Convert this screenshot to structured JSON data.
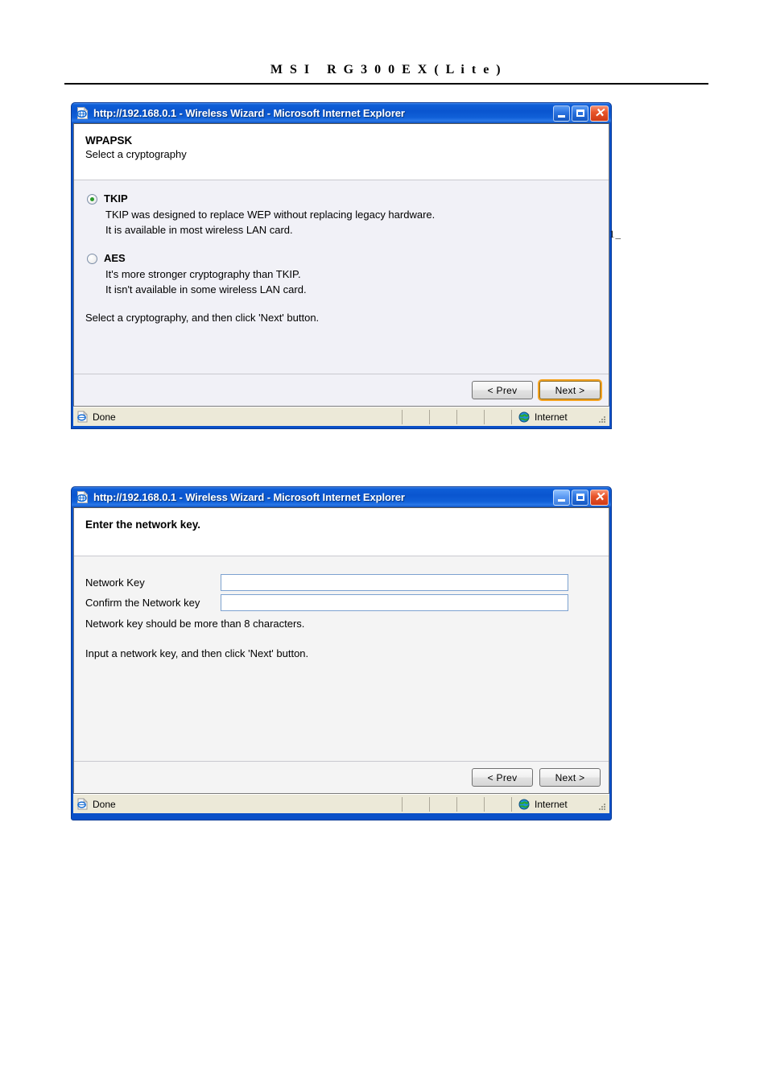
{
  "document": {
    "header_title": "M S I   R G 3 0 0 E X ( L i t e )",
    "margin_artifact": "1_"
  },
  "windows": [
    {
      "title_url": "http://192.168.0.1",
      "title_rest": " - Wireless Wizard - Microsoft Internet Explorer",
      "title_full": "http://192.168.0.1 - Wireless Wizard - Microsoft Internet Explorer",
      "icon": "ie-page-icon",
      "controls": {
        "minimize": "minimize-button",
        "maximize": "maximize-button",
        "close": "close-button"
      },
      "pane": {
        "title": "WPAPSK",
        "subtitle": "Select a cryptography",
        "options": [
          {
            "label": "TKIP",
            "selected": true,
            "desc_line1": "TKIP was designed to replace WEP without replacing legacy hardware.",
            "desc_line2": "It is available in most wireless LAN card."
          },
          {
            "label": "AES",
            "selected": false,
            "desc_line1": "It's more stronger cryptography than TKIP.",
            "desc_line2": "It isn't available in some wireless LAN card."
          }
        ],
        "instruction": "Select a cryptography, and then click 'Next' button."
      },
      "buttons": {
        "prev": "< Prev",
        "next": "Next >",
        "next_focused": true
      },
      "statusbar": {
        "status_text": "Done",
        "zone_text": "Internet"
      }
    },
    {
      "title_url": "http://192.168.0.1",
      "title_rest": " - Wireless Wizard - Microsoft Internet Explorer",
      "title_full": "http://192.168.0.1 - Wireless Wizard - Microsoft Internet Explorer",
      "icon": "ie-page-icon",
      "controls": {
        "minimize": "minimize-button",
        "maximize": "maximize-button",
        "close": "close-button"
      },
      "pane": {
        "title": "Enter the network key.",
        "subtitle": "",
        "fields": [
          {
            "label": "Network Key",
            "value": "",
            "placeholder": ""
          },
          {
            "label": "Confirm the Network key",
            "value": "",
            "placeholder": ""
          }
        ],
        "note": "Network key should be more than 8 characters.",
        "instruction": "Input a network key, and then click 'Next' button."
      },
      "buttons": {
        "prev": "< Prev",
        "next": "Next >",
        "next_focused": false
      },
      "statusbar": {
        "status_text": "Done",
        "zone_text": "Internet"
      }
    }
  ],
  "colors": {
    "titlebar_blue": "#0a55cf",
    "close_red": "#e8552b",
    "radio_dot_green": "#2a9a2a",
    "focus_orange": "#f3a220",
    "statusbar_bg": "#ece9d8",
    "body_tint": "#f1f1f7"
  }
}
